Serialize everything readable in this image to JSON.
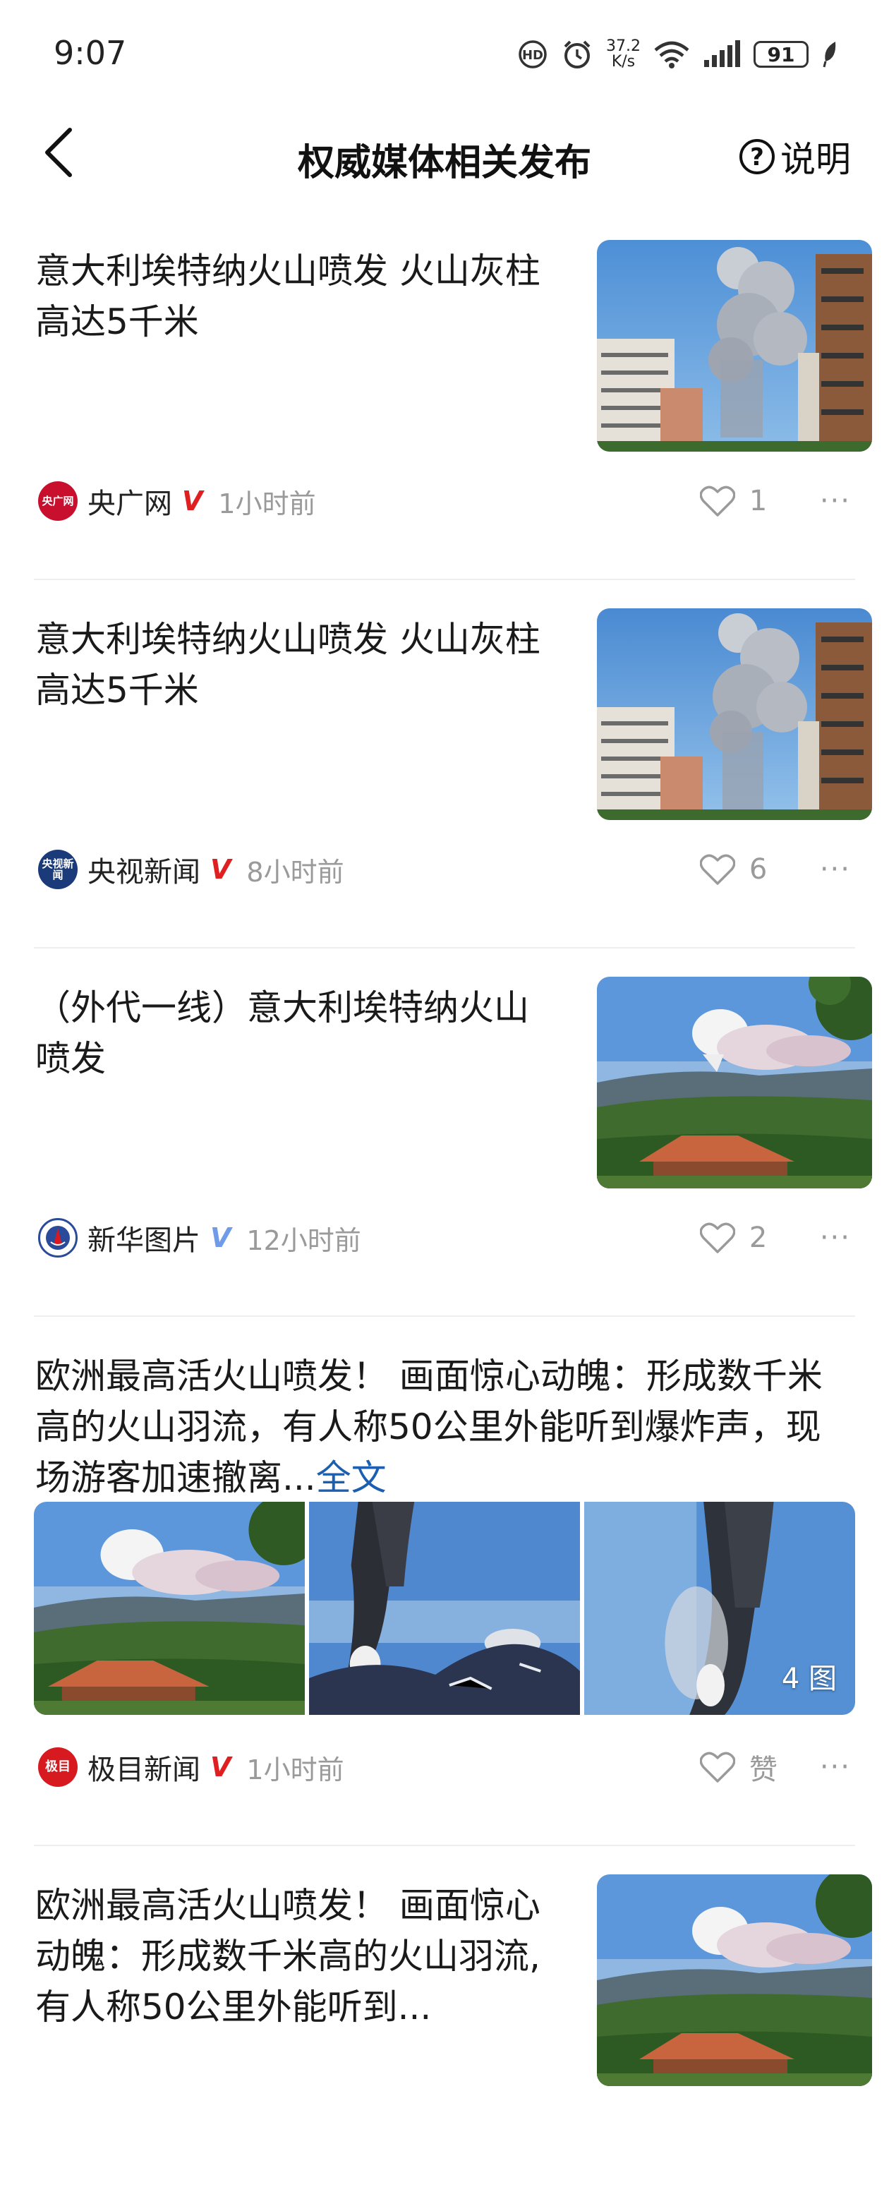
{
  "status_bar": {
    "time": "9:07",
    "network_speed_value": "37.2",
    "network_speed_unit": "K/s",
    "battery": "91",
    "icons": [
      "hd-call-icon",
      "alarm-icon",
      "wifi-icon",
      "signal-icon",
      "battery-icon",
      "leaf-icon"
    ]
  },
  "header": {
    "title": "权威媒体相关发布",
    "help_label": "说明"
  },
  "feed": [
    {
      "title": "意大利埃特纳火山喷发 火山灰柱高达5千米",
      "source": "央广网",
      "avatar_text": "央广网",
      "verified": "V",
      "verified_color": "#e02020",
      "avatar_color": "#c8102e",
      "time": "1小时前",
      "likes": "1"
    },
    {
      "title": "意大利埃特纳火山喷发 火山灰柱高达5千米",
      "source": "央视新闻",
      "avatar_text": "央视新闻",
      "verified": "V",
      "verified_color": "#e02020",
      "avatar_color": "#1b3a7a",
      "time": "8小时前",
      "likes": "6"
    },
    {
      "title": "（外代一线）意大利埃特纳火山喷发",
      "source": "新华图片",
      "verified": "V",
      "verified_color": "#6f9be8",
      "avatar_color": "#2a4a9a",
      "time": "12小时前",
      "likes": "2"
    },
    {
      "title": "欧洲最高活火山喷发！ 画面惊心动魄：形成数千米高的火山羽流，有人称50公里外能听到爆炸声，现场游客加速撤离...",
      "full_text_link": "全文",
      "image_count": "4 图",
      "source": "极目新闻",
      "avatar_text": "极目",
      "verified": "V",
      "verified_color": "#e02020",
      "avatar_color": "#d71920",
      "time": "1小时前",
      "likes": "赞"
    },
    {
      "title": "欧洲最高活火山喷发！ 画面惊心动魄：形成数千米高的火山羽流,有人称50公里外能听到..."
    }
  ],
  "more_label": "···"
}
